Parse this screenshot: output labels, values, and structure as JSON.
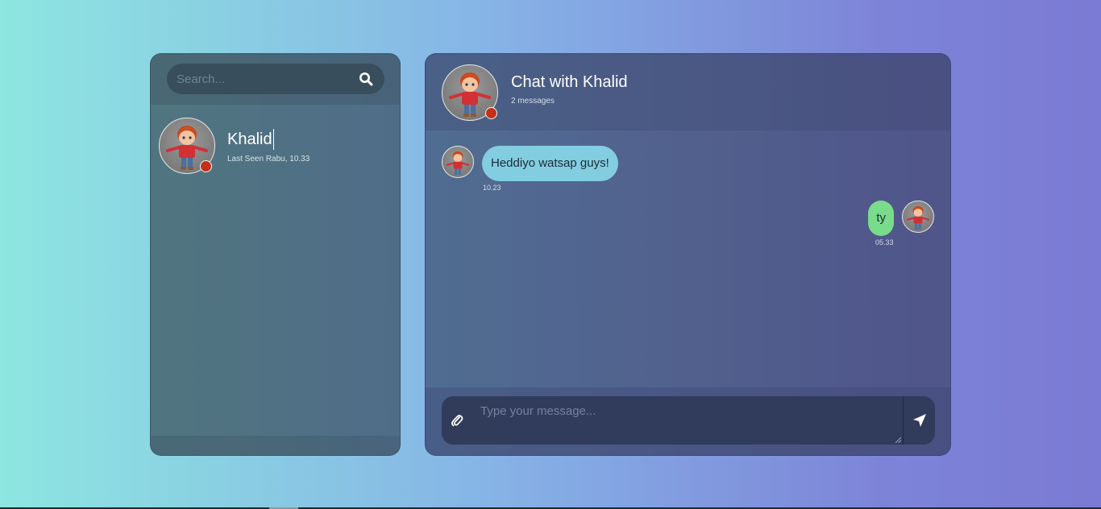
{
  "search": {
    "placeholder": "Search..."
  },
  "contacts": [
    {
      "name": "Khalid",
      "last_seen": "Last Seen Rabu, 10.33",
      "status_color": "#c2311b"
    }
  ],
  "chat": {
    "title": "Chat with Khalid",
    "message_count": "2 messages",
    "messages": [
      {
        "direction": "incoming",
        "text": "Heddiyo watsap guys!",
        "time": "10.23",
        "color": "#82cde0"
      },
      {
        "direction": "outgoing",
        "text": "ty",
        "time": "05.33",
        "color": "#79dc8b"
      }
    ]
  },
  "composer": {
    "placeholder": "Type your message..."
  },
  "icons": {
    "search": "search-icon",
    "attach": "paperclip-icon",
    "send": "send-icon",
    "avatar": "cartoon-boy-avatar"
  }
}
